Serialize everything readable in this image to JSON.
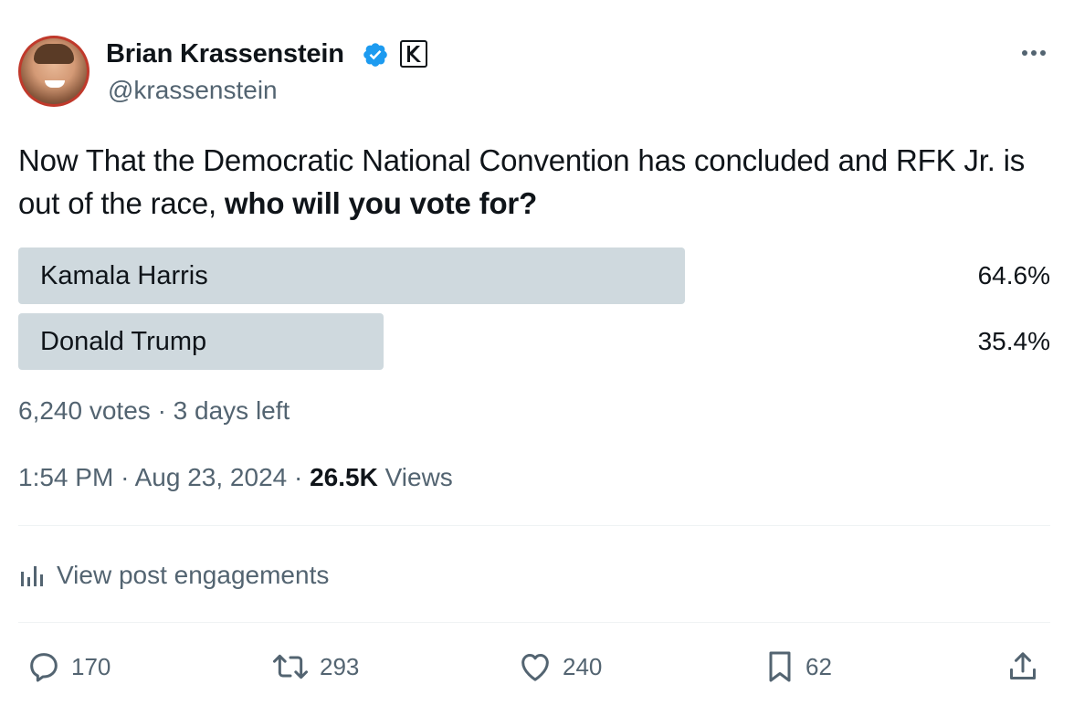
{
  "author": {
    "name": "Brian Krassenstein",
    "handle": "@krassenstein",
    "verified": true,
    "affiliate_badge": "K"
  },
  "post": {
    "text_plain": "Now That the Democratic National Convention has concluded and RFK Jr. is out of the race, ",
    "text_bold": "who will you vote for?"
  },
  "poll": {
    "options": [
      {
        "label": "Kamala Harris",
        "percent_label": "64.6%",
        "fraction": 0.646
      },
      {
        "label": "Donald Trump",
        "percent_label": "35.4%",
        "fraction": 0.354
      }
    ],
    "votes": "6,240 votes",
    "separator": "·",
    "time_left": "3 days left",
    "bar_color": "#cfd9de"
  },
  "timestamp": {
    "time": "1:54 PM",
    "date": "Aug 23, 2024",
    "views_count": "26.5K",
    "views_label": "Views"
  },
  "engagements_link": "View post engagements",
  "actions": {
    "replies": "170",
    "reposts": "293",
    "likes": "240",
    "bookmarks": "62"
  },
  "colors": {
    "verified": "#1d9bf0",
    "secondary_text": "#536471",
    "primary_text": "#0f1419",
    "avatar_ring": "#c0392b"
  }
}
